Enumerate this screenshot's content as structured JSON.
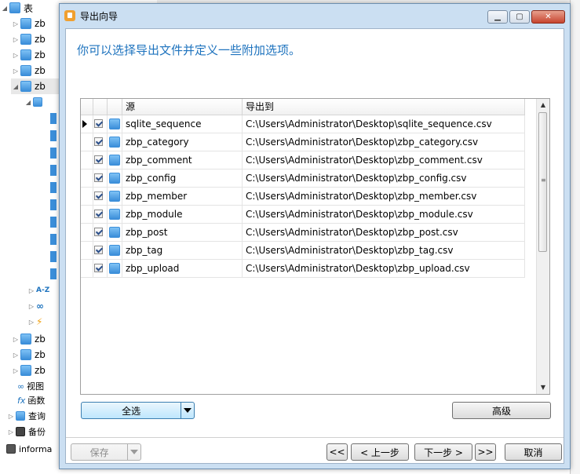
{
  "background": {
    "tree": {
      "root_label": "表",
      "table_items": [
        "zb",
        "zb",
        "zb",
        "zb",
        "zb"
      ],
      "sub_items": [
        "A-Z"
      ],
      "more_tables": [
        "zb",
        "zb",
        "zb"
      ],
      "nodes": [
        "视图",
        "函数",
        "查询",
        "备份"
      ],
      "bottom_item": "informa"
    }
  },
  "dialog": {
    "title": "导出向导",
    "heading": "你可以选择导出文件并定义一些附加选项。",
    "grid": {
      "columns": [
        "源",
        "导出到"
      ],
      "rows": [
        {
          "source": "sqlite_sequence",
          "target": "C:\\Users\\Administrator\\Desktop\\sqlite_sequence.csv",
          "checked": true,
          "current": true
        },
        {
          "source": "zbp_category",
          "target": "C:\\Users\\Administrator\\Desktop\\zbp_category.csv",
          "checked": true,
          "current": false
        },
        {
          "source": "zbp_comment",
          "target": "C:\\Users\\Administrator\\Desktop\\zbp_comment.csv",
          "checked": true,
          "current": false
        },
        {
          "source": "zbp_config",
          "target": "C:\\Users\\Administrator\\Desktop\\zbp_config.csv",
          "checked": true,
          "current": false
        },
        {
          "source": "zbp_member",
          "target": "C:\\Users\\Administrator\\Desktop\\zbp_member.csv",
          "checked": true,
          "current": false
        },
        {
          "source": "zbp_module",
          "target": "C:\\Users\\Administrator\\Desktop\\zbp_module.csv",
          "checked": true,
          "current": false
        },
        {
          "source": "zbp_post",
          "target": "C:\\Users\\Administrator\\Desktop\\zbp_post.csv",
          "checked": true,
          "current": false
        },
        {
          "source": "zbp_tag",
          "target": "C:\\Users\\Administrator\\Desktop\\zbp_tag.csv",
          "checked": true,
          "current": false
        },
        {
          "source": "zbp_upload",
          "target": "C:\\Users\\Administrator\\Desktop\\zbp_upload.csv",
          "checked": true,
          "current": false
        }
      ]
    },
    "buttons": {
      "select_all": "全选",
      "advanced": "高级",
      "save": "保存",
      "first": "<<",
      "prev": "< 上一步",
      "next": "下一步 >",
      "last": ">>",
      "cancel": "取消"
    }
  }
}
